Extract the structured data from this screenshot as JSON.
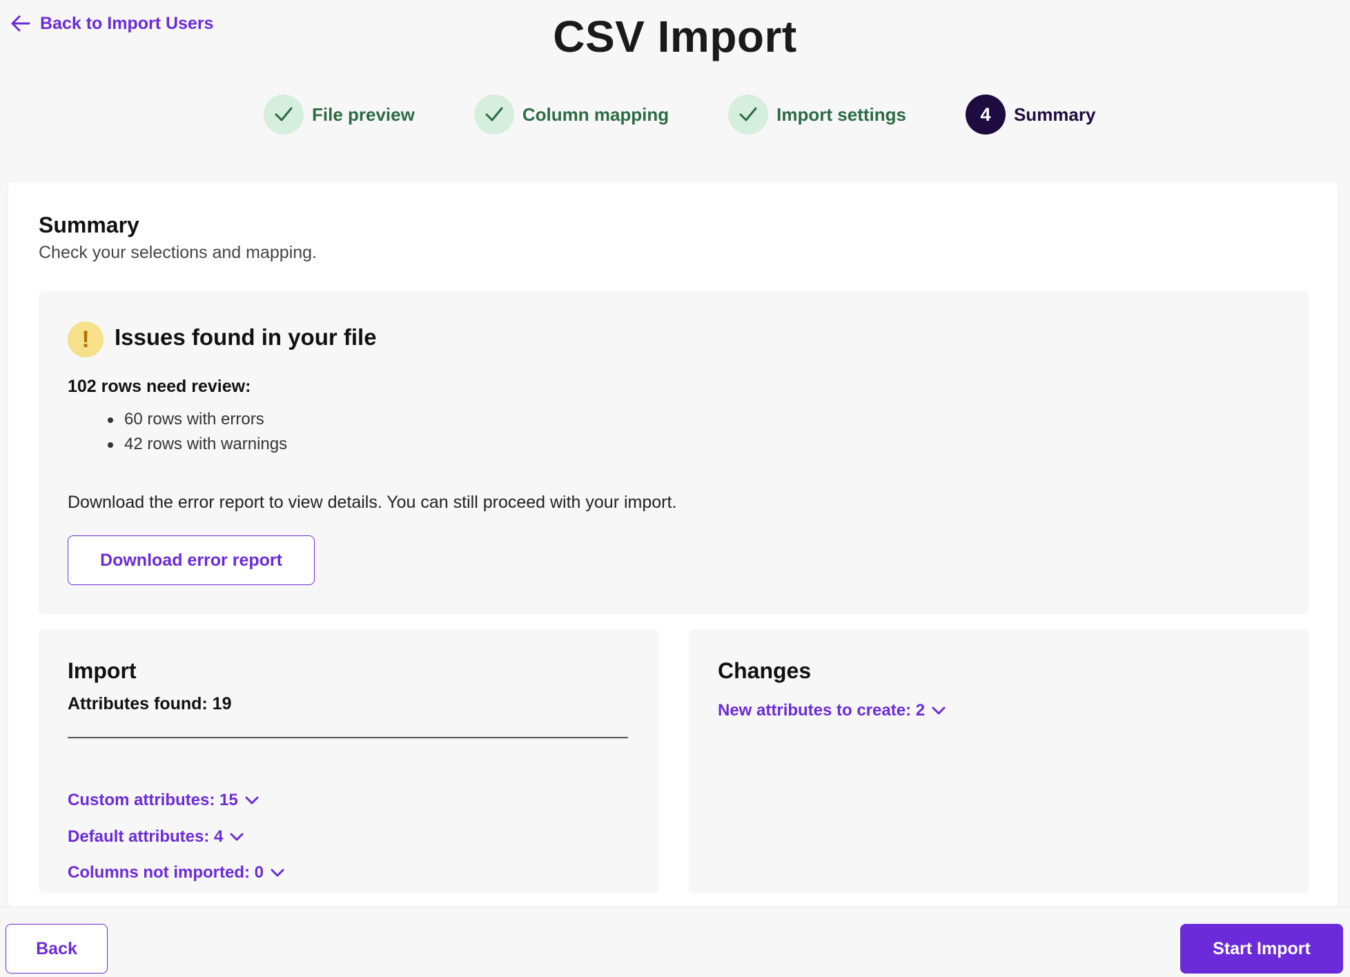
{
  "header": {
    "back_link": "Back to Import Users",
    "title": "CSV Import"
  },
  "stepper": {
    "steps": [
      {
        "label": "File preview",
        "state": "done",
        "icon": "check-icon"
      },
      {
        "label": "Column mapping",
        "state": "done",
        "icon": "check-icon"
      },
      {
        "label": "Import settings",
        "state": "done",
        "icon": "check-icon"
      },
      {
        "label": "Summary",
        "state": "current",
        "number": "4"
      }
    ]
  },
  "summary": {
    "title": "Summary",
    "subtitle": "Check your selections and mapping."
  },
  "issues": {
    "icon": "warning-icon",
    "icon_glyph": "!",
    "title": "Issues found in your file",
    "rows_review": "102 rows need review:",
    "items": [
      "60 rows with errors",
      "42 rows with warnings"
    ],
    "download_text": "Download the error report to view details. You can still proceed with your import.",
    "download_button": "Download error report"
  },
  "import_panel": {
    "title": "Import",
    "attributes_found": "Attributes found: 19",
    "expanders": [
      "Custom attributes: 15",
      "Default attributes: 4",
      "Columns not imported: 0"
    ]
  },
  "changes_panel": {
    "title": "Changes",
    "expanders": [
      "New attributes to create: 2"
    ]
  },
  "footer": {
    "back_button": "Back",
    "start_button": "Start Import"
  },
  "colors": {
    "accent": "#6c2bd9",
    "done_bg": "#d6eedd",
    "done_text": "#2c6b44",
    "current_bg": "#1e0b3f",
    "warning_bg": "#f7e08a"
  }
}
